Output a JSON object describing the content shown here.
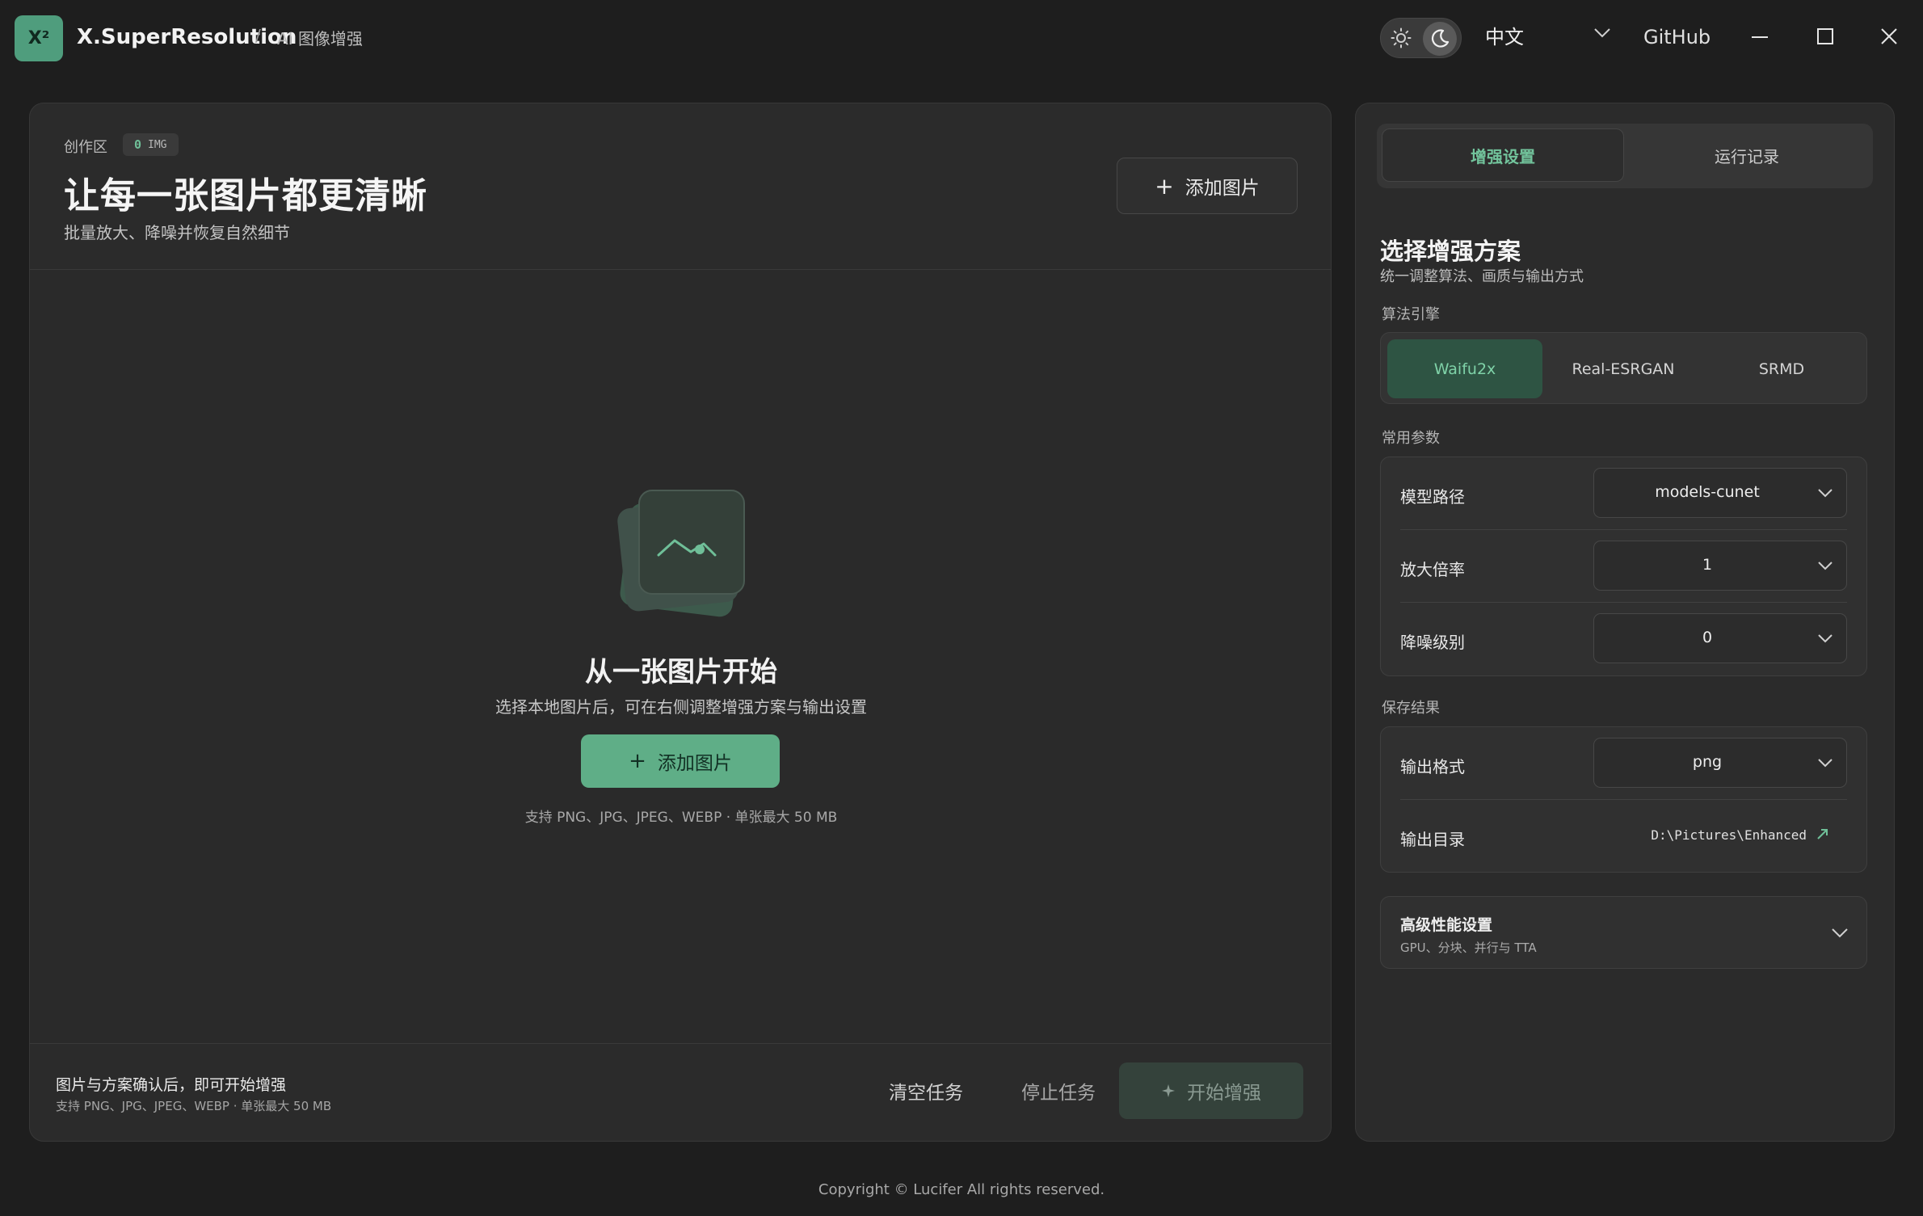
{
  "app": {
    "logo_text": "X²",
    "title": "X.SuperResolution",
    "breadcrumb_sep": "/",
    "breadcrumb": "AI 图像增强"
  },
  "titlebar": {
    "theme_mode": "dark",
    "language": "中文",
    "github_label": "GitHub",
    "icons": [
      "sun-icon",
      "moon-icon",
      "chevron-down-icon",
      "minimize-icon",
      "maximize-icon",
      "close-icon"
    ]
  },
  "workspace": {
    "section_label": "创作区",
    "count": "0",
    "count_unit": "IMG",
    "title": "让每一张图片都更清晰",
    "subtitle": "批量放大、降噪并恢复自然细节",
    "add_button": "添加图片"
  },
  "empty_state": {
    "title": "从一张图片开始",
    "subtitle": "选择本地图片后，可在右侧调整增强方案与输出设置",
    "add_button": "添加图片",
    "support_note": "支持 PNG、JPG、JPEG、WEBP · 单张最大 50 MB"
  },
  "footer_bar": {
    "title": "图片与方案确认后，即可开始增强",
    "subtitle": "支持 PNG、JPG、JPEG、WEBP · 单张最大 50 MB",
    "clear_button": "清空任务",
    "stop_button": "停止任务",
    "start_button": "开始增强"
  },
  "settings": {
    "tabs": [
      "增强设置",
      "运行记录"
    ],
    "active_tab": "增强设置",
    "heading": "选择增强方案",
    "subheading": "统一调整算法、画质与输出方式",
    "engine_label": "算法引擎",
    "engines": [
      "Waifu2x",
      "Real-ESRGAN",
      "SRMD"
    ],
    "active_engine": "Waifu2x",
    "common_label": "常用参数",
    "params": [
      {
        "label": "模型路径",
        "value": "models-cunet"
      },
      {
        "label": "放大倍率",
        "value": "1"
      },
      {
        "label": "降噪级别",
        "value": "0"
      }
    ],
    "save_label": "保存结果",
    "output_format_label": "输出格式",
    "output_format": "png",
    "output_dir_label": "输出目录",
    "output_dir": "D:\\Pictures\\Enhanced",
    "advanced_title": "高级性能设置",
    "advanced_sub": "GPU、分块、并行与 TTA"
  },
  "colors": {
    "accent": "#5fae87",
    "accent_text": "#72c49c",
    "background": "#1e1e1e",
    "card": "#2b2b2b"
  },
  "copyright": "Copyright © Lucifer All rights reserved."
}
